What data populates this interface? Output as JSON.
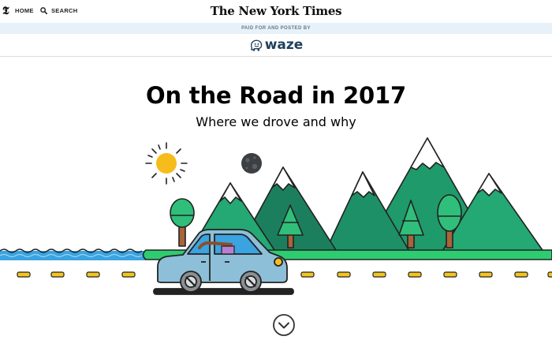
{
  "nav": {
    "logo_glyph": "𝕿",
    "home_label": "HOME",
    "search_label": "SEARCH",
    "masthead": "The New York Times"
  },
  "sponsor": {
    "strip_label": "PAID FOR AND POSTED BY",
    "brand_name": "waze"
  },
  "hero": {
    "title": "On the Road in 2017",
    "subtitle": "Where we drove and why"
  },
  "icons": {
    "search": "search-icon",
    "waze": "waze-logo-icon",
    "scroll": "chevron-down-circle-icon"
  },
  "colors": {
    "sponsor_strip_bg": "#e6f1fa",
    "mountain_green": "#1f9a6b",
    "tree_green": "#2fbf7a",
    "grass_green": "#2ecc71",
    "water_blue": "#3aa3e0",
    "car_blue": "#8ebfd8",
    "sun_yellow": "#f5bc1c",
    "road_dash": "#f3c521"
  }
}
